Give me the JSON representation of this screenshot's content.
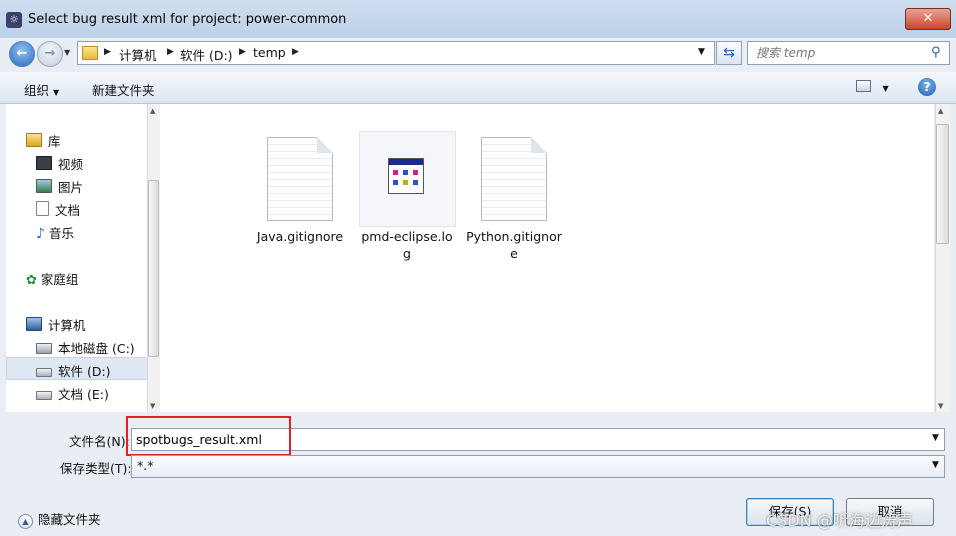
{
  "window": {
    "title": "Select bug result xml for project: power-common",
    "close_label": "✕"
  },
  "nav": {
    "breadcrumbs": [
      "计算机",
      "软件 (D:)",
      "temp"
    ],
    "search_placeholder": "搜索 temp"
  },
  "toolbar": {
    "organize": "组织",
    "new_folder": "新建文件夹"
  },
  "sidebar": {
    "library": {
      "label": "库",
      "items": [
        "视频",
        "图片",
        "文档",
        "音乐"
      ]
    },
    "homegroup": "家庭组",
    "computer": {
      "label": "计算机",
      "items": [
        "本地磁盘 (C:)",
        "软件 (D:)",
        "文档 (E:)"
      ]
    }
  },
  "files": [
    {
      "name_line1": "Java.gitignore",
      "name_line2": ""
    },
    {
      "name_line1": "pmd-eclipse.lo",
      "name_line2": "g"
    },
    {
      "name_line1": "Python.gitignor",
      "name_line2": "e"
    }
  ],
  "form": {
    "filename_label": "文件名(N):",
    "filename_value": "spotbugs_result.xml",
    "filetype_label": "保存类型(T):",
    "filetype_value": "*.*"
  },
  "footer": {
    "hide_folders": "隐藏文件夹",
    "save": "保存(S)",
    "cancel": "取消"
  },
  "watermark": "CSDN @听海边涛声",
  "colors": {
    "highlight_box": "#e0202a",
    "selection": "#dfe7f2"
  }
}
